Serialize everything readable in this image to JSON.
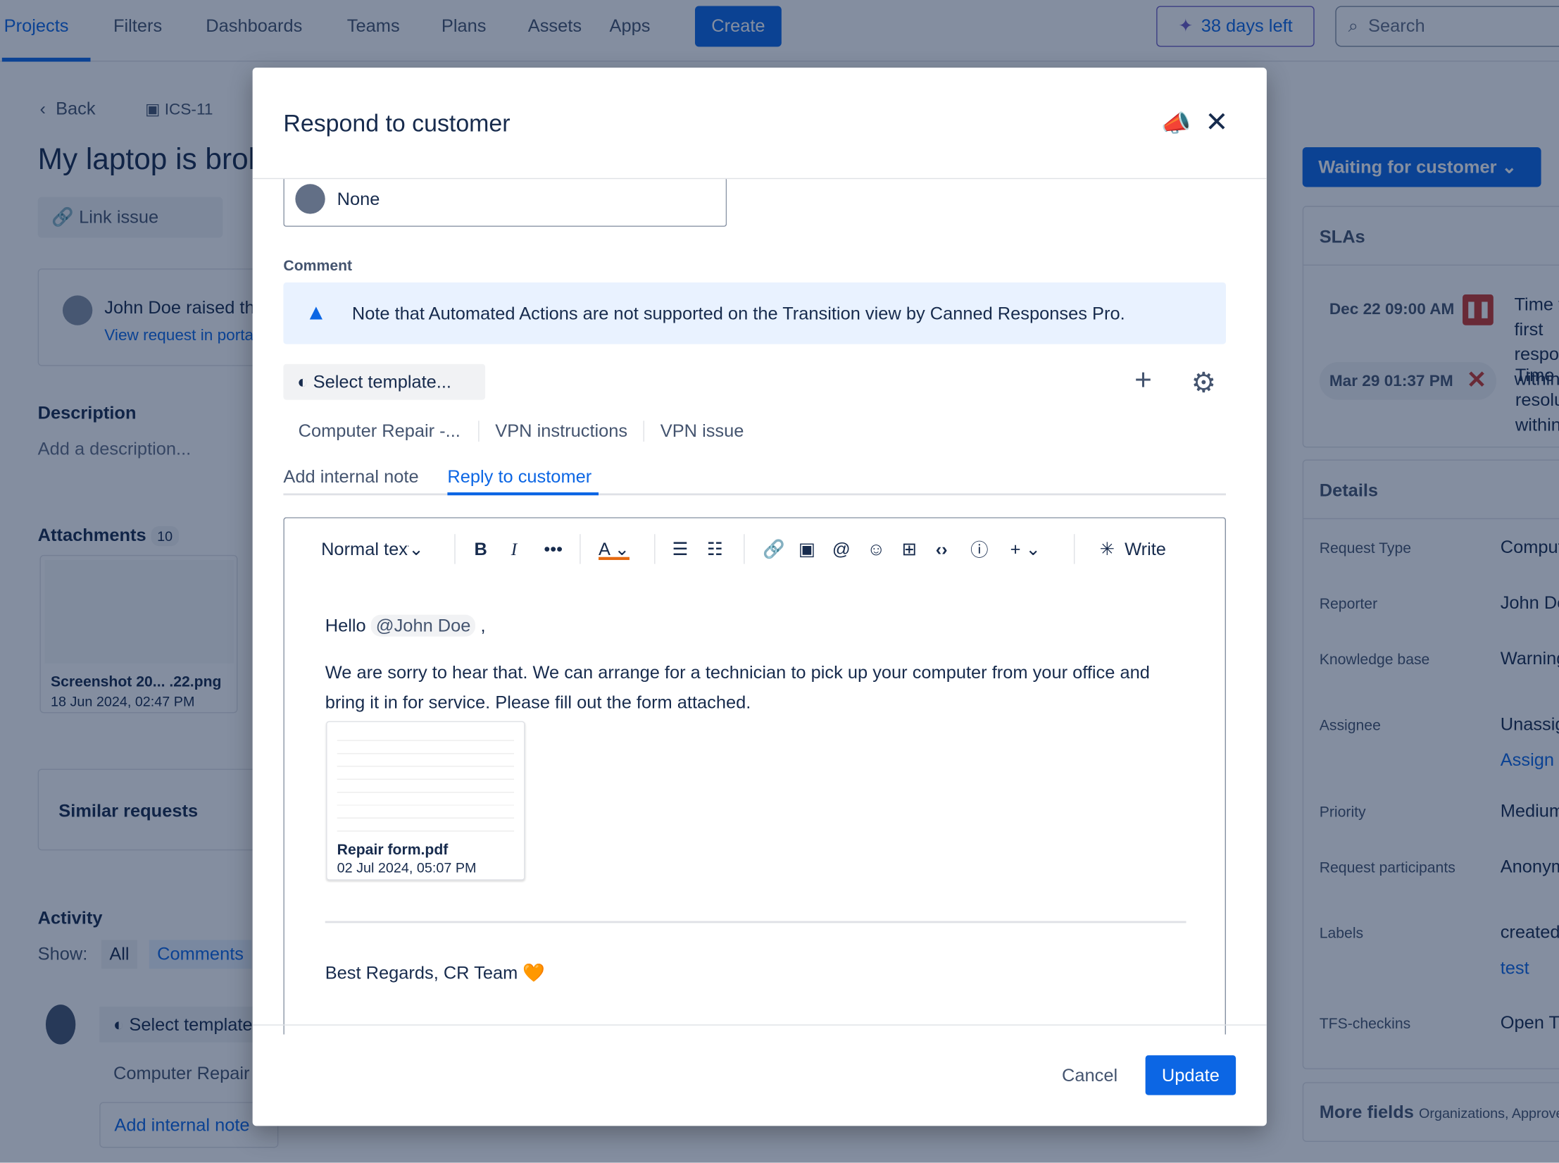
{
  "nav": {
    "items": [
      "Projects",
      "Filters",
      "Dashboards",
      "Teams",
      "Plans",
      "Assets",
      "Apps"
    ],
    "create": "Create",
    "trial": "38 days left",
    "search_placeholder": "Search"
  },
  "issue": {
    "back": "Back",
    "key": "ICS-11",
    "title": "My laptop is broken",
    "link_issue": "Link issue",
    "raised_by": "John Doe raised this request",
    "view_request": "View request in portal",
    "description_label": "Description",
    "description_placeholder": "Add a description...",
    "attachments_label": "Attachments",
    "attachments_count": "10",
    "attachment_name": "Screenshot 20... .22.png",
    "attachment_date": "18 Jun 2024, 02:47 PM",
    "similar": "Similar requests",
    "activity": "Activity",
    "show": "Show:",
    "filter_all": "All",
    "filter_comments": "Comments",
    "select_template": "Select template...",
    "quick_template": "Computer Repair",
    "add_note": "Add internal note",
    "reply": "Reply to customer"
  },
  "sidebar": {
    "status": "Waiting for customer",
    "slas_label": "SLAs",
    "slas": [
      {
        "time": "Dec 22 09:00 AM",
        "state": "paused",
        "text": "Time to first response within"
      },
      {
        "time": "Mar 29 01:37 PM",
        "state": "breached",
        "text": "Time to resolution within"
      }
    ],
    "details_label": "Details",
    "details": [
      {
        "label": "Request Type",
        "value": "Computer support"
      },
      {
        "label": "Reporter",
        "value": "John Doe"
      },
      {
        "label": "Knowledge base",
        "value": "Warning"
      },
      {
        "label": "Assignee",
        "value": "Unassigned",
        "extra": "Assign to me"
      },
      {
        "label": "Priority",
        "value": "Medium"
      },
      {
        "label": "Request participants",
        "value": "Anonymous"
      },
      {
        "label": "Labels",
        "value": "created",
        "extra": "test"
      },
      {
        "label": "TFS-checkins",
        "value": "Open TFS"
      }
    ],
    "more_fields": "More fields",
    "more_fields_sub": "Organizations, Approvers"
  },
  "modal": {
    "title": "Respond to customer",
    "select_value": "None",
    "comment_label": "Comment",
    "banner": "Note that Automated Actions are not supported on the Transition view by Canned Responses Pro.",
    "select_template": "Select template...",
    "quick_templates": [
      "Computer Repair -...",
      "VPN instructions",
      "VPN issue"
    ],
    "tabs": [
      "Add internal note",
      "Reply to customer"
    ],
    "active_tab": "Reply to customer",
    "toolbar": {
      "text_style": "Normal text",
      "write": "Write"
    },
    "body": {
      "greeting": "Hello",
      "mention": "@John Doe",
      "comma": ",",
      "paragraph": "We are sorry to hear that. We can arrange for a technician to pick up your computer from your office and bring it in for service. Please fill out the form attached.",
      "attachment_name": "Repair form.pdf",
      "attachment_date": "02 Jul 2024, 05:07 PM",
      "signature": "Best Regards, CR Team 🧡"
    },
    "cancel": "Cancel",
    "update": "Update"
  },
  "colors": {
    "brand": "#0c66e4",
    "banner_bg": "#e9f2ff",
    "warning": "#e56910",
    "danger": "#c9372c"
  }
}
